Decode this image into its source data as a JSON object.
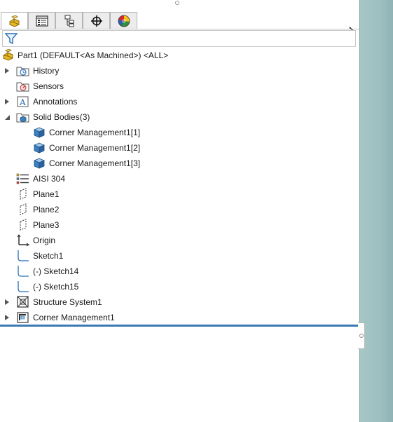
{
  "tabs": [
    {
      "name": "featuremanager-tab",
      "icon": "part-feature-icon",
      "active": true
    },
    {
      "name": "propertymanager-tab",
      "icon": "property-list-icon",
      "active": false
    },
    {
      "name": "configurationmanager-tab",
      "icon": "configuration-icon",
      "active": false
    },
    {
      "name": "dimxpertmanager-tab",
      "icon": "crosshair-icon",
      "active": false
    },
    {
      "name": "displaymanager-tab",
      "icon": "color-wheel-icon",
      "active": false
    }
  ],
  "filter": {
    "placeholder": "",
    "value": ""
  },
  "tree": {
    "root": "Part1 (DEFAULT<As Machined>) <ALL>",
    "history": "History",
    "sensors": "Sensors",
    "annotations": "Annotations",
    "solid_bodies": "Solid Bodies(3)",
    "body1": "Corner Management1[1]",
    "body2": "Corner Management1[2]",
    "body3": "Corner Management1[3]",
    "material": "AISI 304",
    "plane1": "Plane1",
    "plane2": "Plane2",
    "plane3": "Plane3",
    "origin": "Origin",
    "sketch1": "Sketch1",
    "sketch14": "(-) Sketch14",
    "sketch15": "(-) Sketch15",
    "structure": "Structure System1",
    "corner_mgmt": "Corner Management1"
  },
  "colors": {
    "rollback_bar": "#3b7ab5",
    "body_blue": "#3d7fbf",
    "part_yellow": "#e8b923"
  }
}
